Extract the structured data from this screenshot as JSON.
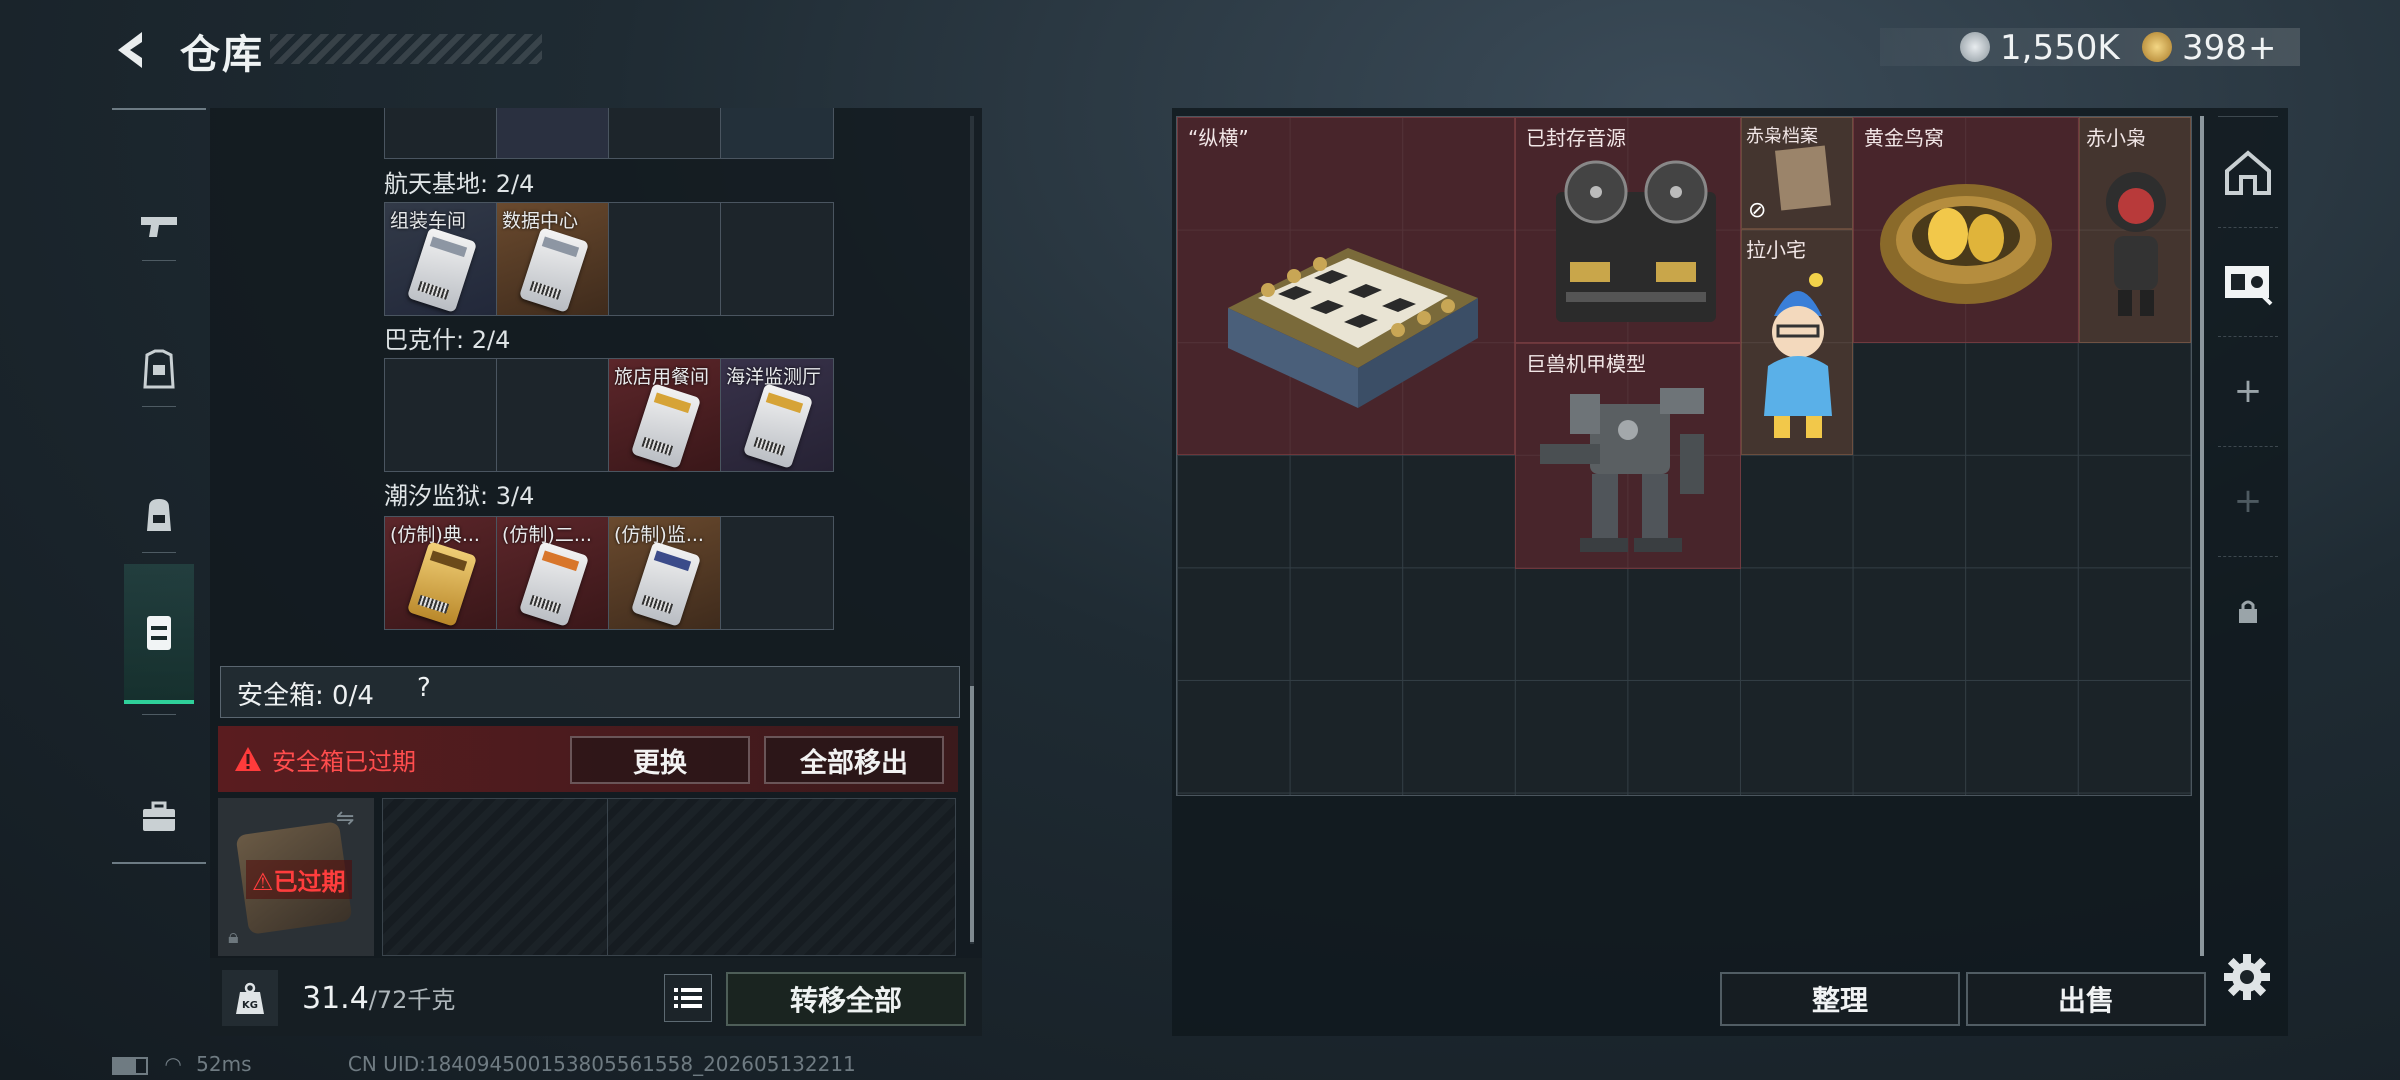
{
  "header": {
    "title": "仓库"
  },
  "currency": {
    "silver": "1,550K",
    "gold": "398"
  },
  "nav": {
    "items": [
      "pistol-icon",
      "armor-icon",
      "backpack-icon",
      "chest-rig-icon",
      "briefcase-icon"
    ],
    "active": 3
  },
  "left": {
    "groups": [
      {
        "label": "航天基地: 2/4",
        "cells": [
          {
            "label": "组装车间",
            "tone": "item",
            "card": ""
          },
          {
            "label": "数据中心",
            "tone": "item orange",
            "card": ""
          },
          {
            "label": "",
            "tone": "",
            "card": null
          },
          {
            "label": "",
            "tone": "",
            "card": null
          }
        ]
      },
      {
        "label": "巴克什: 2/4",
        "cells": [
          {
            "label": "",
            "tone": "",
            "card": null
          },
          {
            "label": "",
            "tone": "",
            "card": null
          },
          {
            "label": "旅店用餐间",
            "tone": "item red",
            "card": "gold"
          },
          {
            "label": "海洋监测厅",
            "tone": "item purple",
            "card": "gold"
          }
        ]
      },
      {
        "label": "潮汐监狱: 3/4",
        "cells": [
          {
            "label": "(仿制)典...",
            "tone": "item red",
            "card": "goldfull"
          },
          {
            "label": "(仿制)二...",
            "tone": "item red",
            "card": "orangec"
          },
          {
            "label": "(仿制)监...",
            "tone": "item orange",
            "card": "navy"
          },
          {
            "label": "",
            "tone": "",
            "card": null
          }
        ]
      }
    ],
    "safe": {
      "title": "安全箱: 0/4",
      "help": "?",
      "warning": "安全箱已过期",
      "replace": "更换",
      "remove_all": "全部移出",
      "expired": "已过期"
    },
    "weight": {
      "current": "31.4",
      "max": "/72千克",
      "kg_badge": "KG"
    },
    "transfer_all": "转移全部"
  },
  "status": {
    "ping": "52ms",
    "uid": "CN UID:18409450015380556​1558_202605132211"
  },
  "stash": {
    "items": [
      {
        "label": "“纵横”",
        "tone": "",
        "kind": "chess"
      },
      {
        "label": "已封存音源",
        "tone": "",
        "kind": "reel"
      },
      {
        "label": "赤枭档案",
        "tone": "brown",
        "kind": "folder"
      },
      {
        "label": "黄金鸟窝",
        "tone": "",
        "kind": "nest"
      },
      {
        "label": "赤小枭",
        "tone": "brown",
        "kind": "doll"
      },
      {
        "label": "拉小宅",
        "tone": "brown",
        "kind": "figure"
      },
      {
        "label": "巨兽机甲模型",
        "tone": "",
        "kind": "mech"
      }
    ],
    "sort": "整理",
    "sell": "出售"
  }
}
